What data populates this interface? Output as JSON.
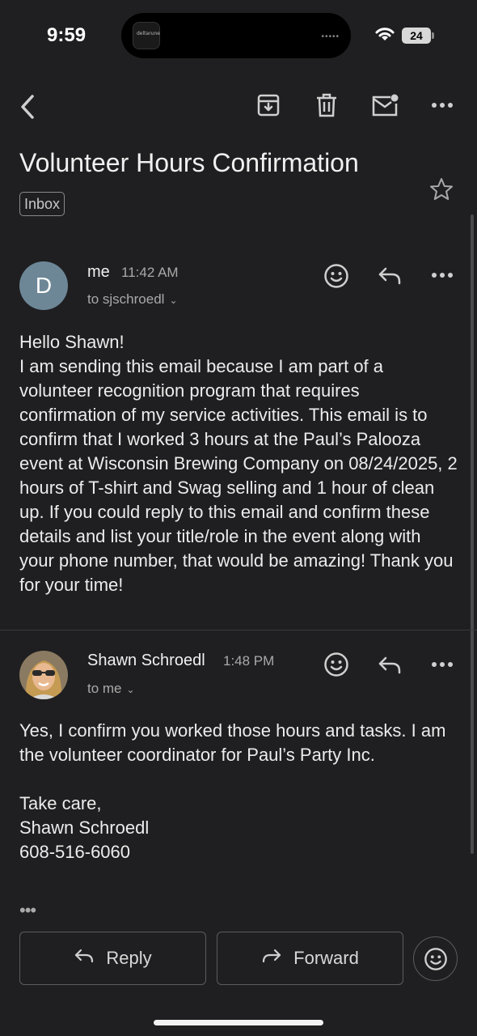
{
  "status_bar": {
    "time": "9:59",
    "battery": "24"
  },
  "email": {
    "subject": "Volunteer Hours Confirmation",
    "label": "Inbox"
  },
  "messages": [
    {
      "avatar_letter": "D",
      "sender": "me",
      "time": "11:42 AM",
      "to": "to sjschroedl",
      "body": "Hello Shawn!\nI am sending this email because I am part of a volunteer recognition program that requires confirmation of my service activities. This email is to confirm that I worked 3 hours at the Paul’s Palooza event at Wisconsin Brewing Company on 08/24/2025, 2 hours of T-shirt and Swag selling and 1 hour of clean up. If you could reply to this email and confirm these details and list your title/role in the event along with your phone number, that would be amazing! Thank you for your time!"
    },
    {
      "sender": "Shawn Schroedl",
      "time": "1:48 PM",
      "to": "to me",
      "body": "Yes, I confirm you worked those hours and tasks. I am the volunteer coordinator for Paul’s Party Inc.\n\nTake care,\nShawn Schroedl\n608-516-6060"
    }
  ],
  "actions": {
    "reply": "Reply",
    "forward": "Forward"
  },
  "colors": {
    "background": "#1f1f21",
    "avatar_me": "#6d8797",
    "text": "#ececec",
    "muted": "#a9a9a9"
  }
}
